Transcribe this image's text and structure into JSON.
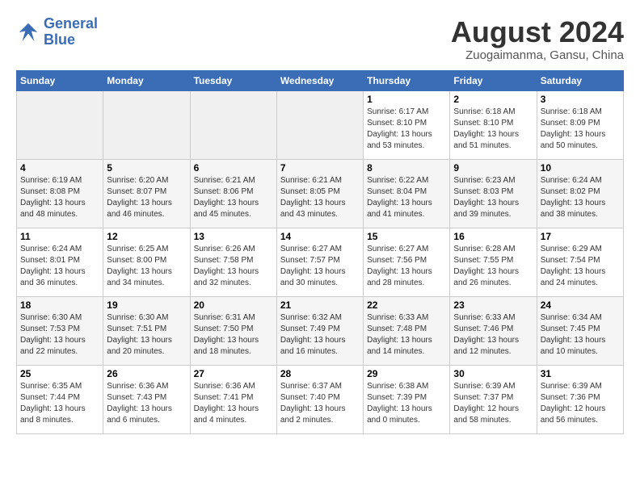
{
  "logo": {
    "text_general": "General",
    "text_blue": "Blue"
  },
  "header": {
    "title": "August 2024",
    "location": "Zuogaimanma, Gansu, China"
  },
  "weekdays": [
    "Sunday",
    "Monday",
    "Tuesday",
    "Wednesday",
    "Thursday",
    "Friday",
    "Saturday"
  ],
  "weeks": [
    [
      {
        "day": "",
        "info": ""
      },
      {
        "day": "",
        "info": ""
      },
      {
        "day": "",
        "info": ""
      },
      {
        "day": "",
        "info": ""
      },
      {
        "day": "1",
        "info": "Sunrise: 6:17 AM\nSunset: 8:10 PM\nDaylight: 13 hours\nand 53 minutes."
      },
      {
        "day": "2",
        "info": "Sunrise: 6:18 AM\nSunset: 8:10 PM\nDaylight: 13 hours\nand 51 minutes."
      },
      {
        "day": "3",
        "info": "Sunrise: 6:18 AM\nSunset: 8:09 PM\nDaylight: 13 hours\nand 50 minutes."
      }
    ],
    [
      {
        "day": "4",
        "info": "Sunrise: 6:19 AM\nSunset: 8:08 PM\nDaylight: 13 hours\nand 48 minutes."
      },
      {
        "day": "5",
        "info": "Sunrise: 6:20 AM\nSunset: 8:07 PM\nDaylight: 13 hours\nand 46 minutes."
      },
      {
        "day": "6",
        "info": "Sunrise: 6:21 AM\nSunset: 8:06 PM\nDaylight: 13 hours\nand 45 minutes."
      },
      {
        "day": "7",
        "info": "Sunrise: 6:21 AM\nSunset: 8:05 PM\nDaylight: 13 hours\nand 43 minutes."
      },
      {
        "day": "8",
        "info": "Sunrise: 6:22 AM\nSunset: 8:04 PM\nDaylight: 13 hours\nand 41 minutes."
      },
      {
        "day": "9",
        "info": "Sunrise: 6:23 AM\nSunset: 8:03 PM\nDaylight: 13 hours\nand 39 minutes."
      },
      {
        "day": "10",
        "info": "Sunrise: 6:24 AM\nSunset: 8:02 PM\nDaylight: 13 hours\nand 38 minutes."
      }
    ],
    [
      {
        "day": "11",
        "info": "Sunrise: 6:24 AM\nSunset: 8:01 PM\nDaylight: 13 hours\nand 36 minutes."
      },
      {
        "day": "12",
        "info": "Sunrise: 6:25 AM\nSunset: 8:00 PM\nDaylight: 13 hours\nand 34 minutes."
      },
      {
        "day": "13",
        "info": "Sunrise: 6:26 AM\nSunset: 7:58 PM\nDaylight: 13 hours\nand 32 minutes."
      },
      {
        "day": "14",
        "info": "Sunrise: 6:27 AM\nSunset: 7:57 PM\nDaylight: 13 hours\nand 30 minutes."
      },
      {
        "day": "15",
        "info": "Sunrise: 6:27 AM\nSunset: 7:56 PM\nDaylight: 13 hours\nand 28 minutes."
      },
      {
        "day": "16",
        "info": "Sunrise: 6:28 AM\nSunset: 7:55 PM\nDaylight: 13 hours\nand 26 minutes."
      },
      {
        "day": "17",
        "info": "Sunrise: 6:29 AM\nSunset: 7:54 PM\nDaylight: 13 hours\nand 24 minutes."
      }
    ],
    [
      {
        "day": "18",
        "info": "Sunrise: 6:30 AM\nSunset: 7:53 PM\nDaylight: 13 hours\nand 22 minutes."
      },
      {
        "day": "19",
        "info": "Sunrise: 6:30 AM\nSunset: 7:51 PM\nDaylight: 13 hours\nand 20 minutes."
      },
      {
        "day": "20",
        "info": "Sunrise: 6:31 AM\nSunset: 7:50 PM\nDaylight: 13 hours\nand 18 minutes."
      },
      {
        "day": "21",
        "info": "Sunrise: 6:32 AM\nSunset: 7:49 PM\nDaylight: 13 hours\nand 16 minutes."
      },
      {
        "day": "22",
        "info": "Sunrise: 6:33 AM\nSunset: 7:48 PM\nDaylight: 13 hours\nand 14 minutes."
      },
      {
        "day": "23",
        "info": "Sunrise: 6:33 AM\nSunset: 7:46 PM\nDaylight: 13 hours\nand 12 minutes."
      },
      {
        "day": "24",
        "info": "Sunrise: 6:34 AM\nSunset: 7:45 PM\nDaylight: 13 hours\nand 10 minutes."
      }
    ],
    [
      {
        "day": "25",
        "info": "Sunrise: 6:35 AM\nSunset: 7:44 PM\nDaylight: 13 hours\nand 8 minutes."
      },
      {
        "day": "26",
        "info": "Sunrise: 6:36 AM\nSunset: 7:43 PM\nDaylight: 13 hours\nand 6 minutes."
      },
      {
        "day": "27",
        "info": "Sunrise: 6:36 AM\nSunset: 7:41 PM\nDaylight: 13 hours\nand 4 minutes."
      },
      {
        "day": "28",
        "info": "Sunrise: 6:37 AM\nSunset: 7:40 PM\nDaylight: 13 hours\nand 2 minutes."
      },
      {
        "day": "29",
        "info": "Sunrise: 6:38 AM\nSunset: 7:39 PM\nDaylight: 13 hours\nand 0 minutes."
      },
      {
        "day": "30",
        "info": "Sunrise: 6:39 AM\nSunset: 7:37 PM\nDaylight: 12 hours\nand 58 minutes."
      },
      {
        "day": "31",
        "info": "Sunrise: 6:39 AM\nSunset: 7:36 PM\nDaylight: 12 hours\nand 56 minutes."
      }
    ]
  ]
}
